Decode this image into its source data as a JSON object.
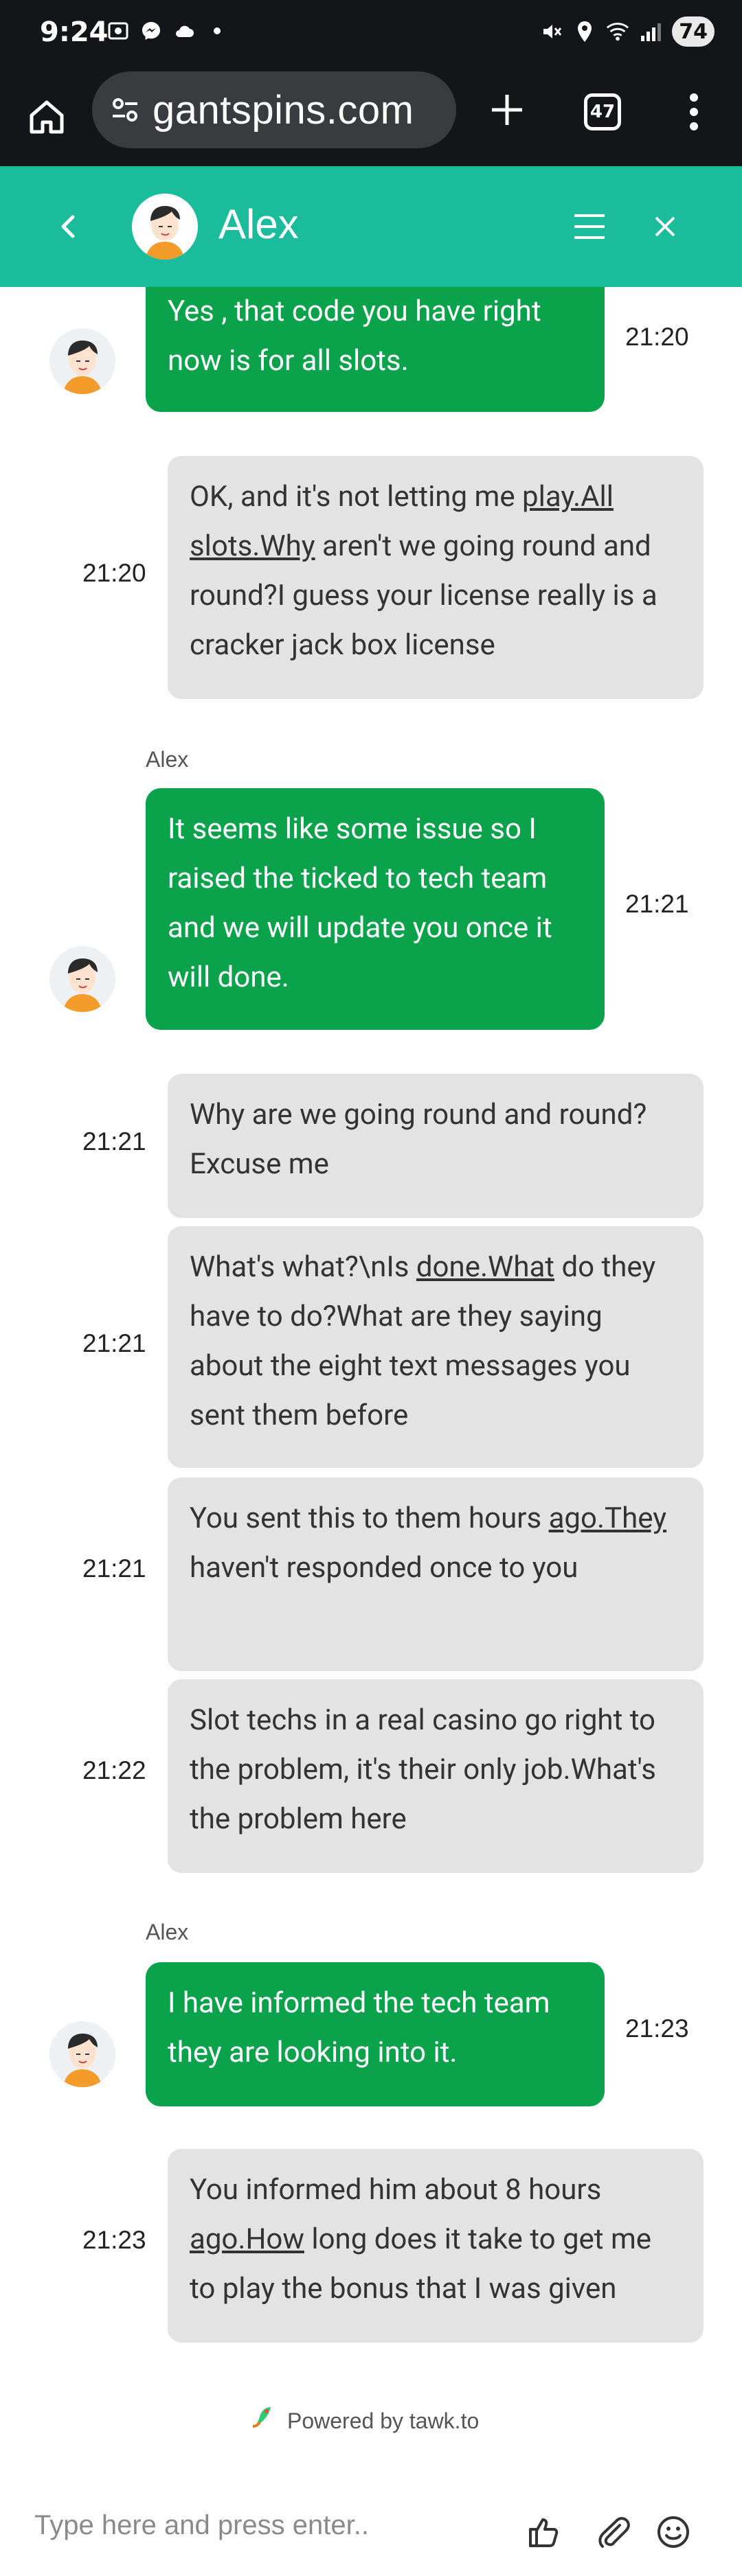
{
  "status_bar": {
    "time": "9:24",
    "battery": "74"
  },
  "browser": {
    "url": "gantspins.com",
    "tab_count": "47"
  },
  "chat": {
    "agent_name": "Alex"
  },
  "messages": [
    {
      "role": "agent",
      "text_parts": [
        "Yes , that code you have right",
        "now is for all slots."
      ],
      "time": "21:20"
    },
    {
      "role": "user",
      "text_html": "OK, and it's not letting me <u>play.All</u><br><u>slots.Why</u> aren't we going round and<br>round?I guess your license really is<br>a cracker jack box license",
      "text": "OK, and it's not letting me play.All slots.Why aren't we going round and round?I guess your license really is a cracker jack box license",
      "time": "21:20"
    },
    {
      "role": "agent",
      "sender": "Alex",
      "text": "It seems like some issue so I raised the ticked to tech team and we will update you once it will done.",
      "time": "21:21"
    },
    {
      "role": "user",
      "text": "Why are we going round and round? Excuse me",
      "time": "21:21"
    },
    {
      "role": "user",
      "text": "What's what?\\nIs done.What do they have to do?What are they saying about the eight text messages you sent them before",
      "time": "21:21"
    },
    {
      "role": "user",
      "text": "You sent this to them hours ago.They haven't responded once to you",
      "time": "21:21"
    },
    {
      "role": "user",
      "text": "Slot techs in a real casino go right to the problem, it's their only job.What's the problem here",
      "time": "21:22"
    },
    {
      "role": "agent",
      "sender": "Alex",
      "text": "I have informed the tech team they are looking into it.",
      "time": "21:23"
    },
    {
      "role": "user",
      "text": "You informed him about 8 hours ago.How long does it take to get me to play the bonus that I was given",
      "time": "21:23"
    }
  ],
  "footer": {
    "powered_by": "Powered by tawk.to",
    "input_placeholder": "Type here and press enter.."
  }
}
